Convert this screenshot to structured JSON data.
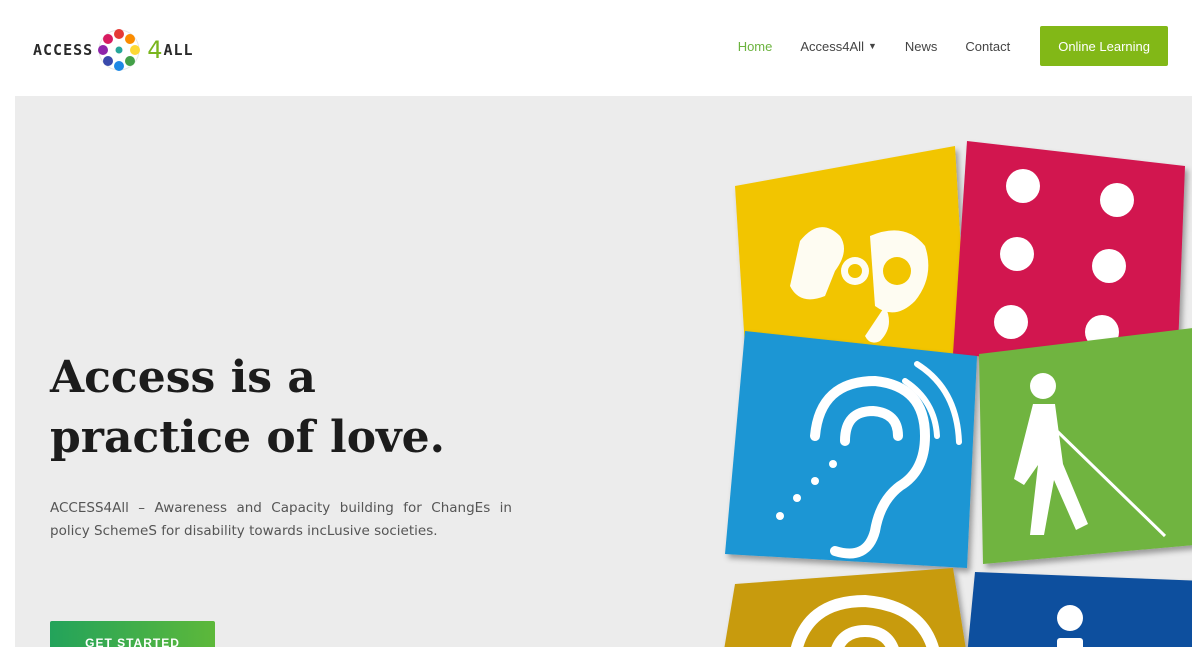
{
  "header": {
    "logo": {
      "text_left": "ACCESS",
      "text_four": "4",
      "text_right": "ALL"
    },
    "nav": [
      {
        "label": "Home",
        "active": true
      },
      {
        "label": "Access4All",
        "has_dropdown": true
      },
      {
        "label": "News"
      },
      {
        "label": "Contact"
      }
    ],
    "cta_label": "Online Learning"
  },
  "hero": {
    "headline_line1": "Access is a",
    "headline_line2": "practice of love.",
    "description": "ACCESS4All – Awareness and Capacity building for ChangEs in policy SchemeS for disability towards incLusive societies.",
    "button_label": "GET STARTED"
  },
  "icons": {
    "sign_language": "sign-language-icon",
    "braille": "braille-icon",
    "hearing": "hearing-assistance-icon",
    "blind": "blind-cane-icon",
    "audio": "audio-icon",
    "info": "information-icon"
  },
  "colors": {
    "accent_green": "#82b817",
    "nav_active": "#6cb33f",
    "tile_yellow": "#f2c500",
    "tile_red": "#d21650",
    "tile_blue": "#1a96d4",
    "tile_green": "#6fb43f",
    "tile_ochre": "#c89b0c",
    "tile_navy": "#0f4f9e"
  }
}
